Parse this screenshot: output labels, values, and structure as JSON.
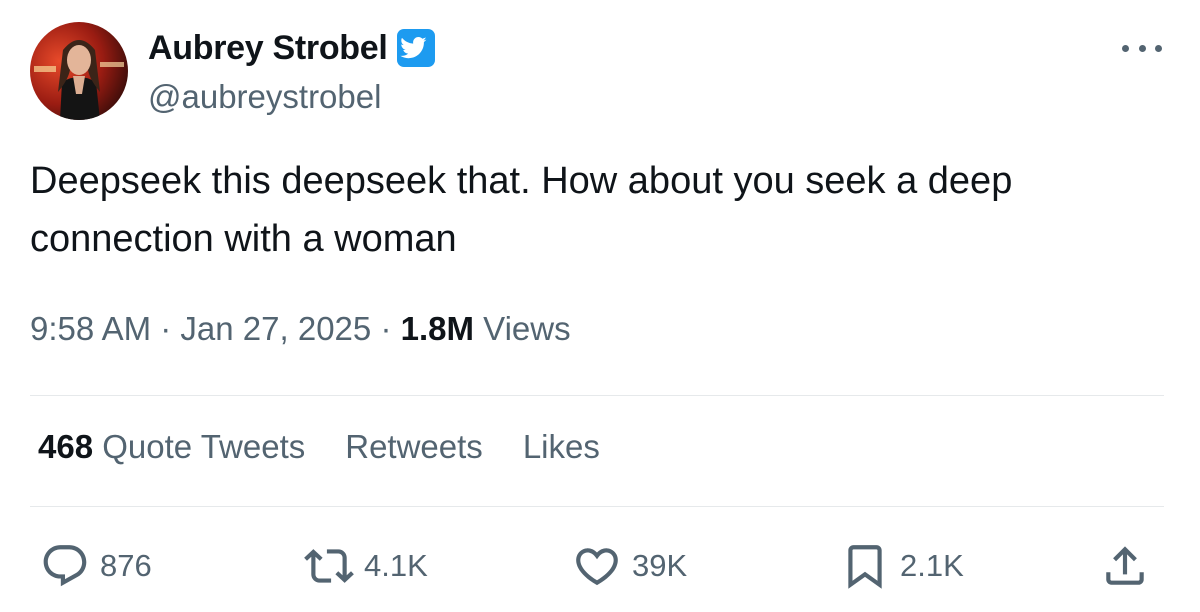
{
  "author": {
    "display_name": "Aubrey Strobel",
    "handle": "@aubreystrobel",
    "verified": true
  },
  "tweet": {
    "text": "Deepseek this deepseek that. How about you seek a deep connection with a woman",
    "time": "9:58 AM",
    "date": "Jan 27, 2025",
    "views_count": "1.8M",
    "views_label": "Views"
  },
  "stats": {
    "quote_tweets_count": "468",
    "quote_tweets_label": "Quote Tweets",
    "retweets_label": "Retweets",
    "likes_label": "Likes"
  },
  "actions": {
    "replies": "876",
    "retweets": "4.1K",
    "likes": "39K",
    "bookmarks": "2.1K"
  },
  "icons": {
    "verified": "verified-badge-icon",
    "more": "more-options-icon",
    "reply": "reply-icon",
    "retweet": "retweet-icon",
    "like": "heart-icon",
    "bookmark": "bookmark-icon",
    "share": "share-icon"
  },
  "colors": {
    "verified_blue": "#1d9bf0",
    "text_primary": "#0f1419",
    "text_secondary": "#536471"
  }
}
